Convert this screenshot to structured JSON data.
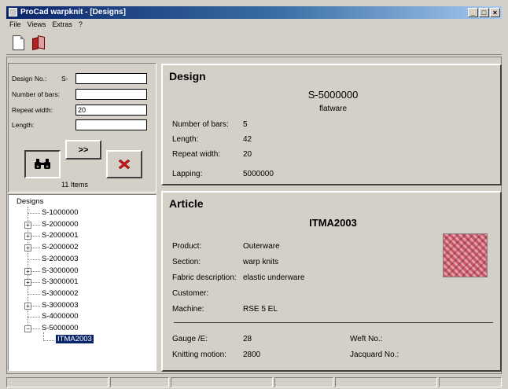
{
  "window": {
    "title": "ProCad warpknit - [Designs]",
    "minimize": "_",
    "restore": "□",
    "close": "×"
  },
  "menu": [
    "File",
    "Views",
    "Extras",
    "?"
  ],
  "toolbar": {
    "new_icon": "new-document-icon",
    "open_icon": "book-icon"
  },
  "search": {
    "design_no_label": "Design No.:",
    "design_prefix": "S-",
    "design_no_value": "",
    "bars_label": "Number of bars:",
    "bars_value": "",
    "repeat_label": "Repeat width:",
    "repeat_value": "20",
    "length_label": "Length:",
    "length_value": "",
    "next_label": ">>",
    "items_count": "11 Items"
  },
  "tree": {
    "root": "Designs",
    "items": [
      {
        "label": "S-1000000",
        "expandable": false
      },
      {
        "label": "S-2000000",
        "expandable": true
      },
      {
        "label": "S-2000001",
        "expandable": true
      },
      {
        "label": "S-2000002",
        "expandable": true
      },
      {
        "label": "S-2000003",
        "expandable": false
      },
      {
        "label": "S-3000000",
        "expandable": true
      },
      {
        "label": "S-3000001",
        "expandable": true
      },
      {
        "label": "S-3000002",
        "expandable": false
      },
      {
        "label": "S-3000003",
        "expandable": true
      },
      {
        "label": "S-4000000",
        "expandable": false
      },
      {
        "label": "S-5000000",
        "expandable": true,
        "expanded": true
      }
    ],
    "selected_child": "ITMA2003"
  },
  "design": {
    "heading": "Design",
    "number": "S-5000000",
    "type": "flatware",
    "bars_label": "Number of bars:",
    "bars_value": "5",
    "length_label": "Length:",
    "length_value": "42",
    "repeat_label": "Repeat width:",
    "repeat_value": "20",
    "lapping_label": "Lapping:",
    "lapping_value": "5000000"
  },
  "article": {
    "heading": "Article",
    "name": "ITMA2003",
    "product_label": "Product:",
    "product_value": "Outerware",
    "section_label": "Section:",
    "section_value": "warp knits",
    "fabric_label": "Fabric description:",
    "fabric_value": "elastic underware",
    "customer_label": "Customer:",
    "customer_value": "",
    "machine_label": "Machine:",
    "machine_value": "RSE 5 EL",
    "gauge_label": "Gauge /E:",
    "gauge_value": "28",
    "motion_label": "Knitting motion:",
    "motion_value": "2800",
    "weft_label": "Weft No.:",
    "weft_value": "",
    "jacquard_label": "Jacquard No.:",
    "jacquard_value": ""
  },
  "colors": {
    "titlebar": "#0a246a",
    "selection": "#0a246a",
    "face": "#d4d0c8",
    "swatch": "#c85868"
  }
}
